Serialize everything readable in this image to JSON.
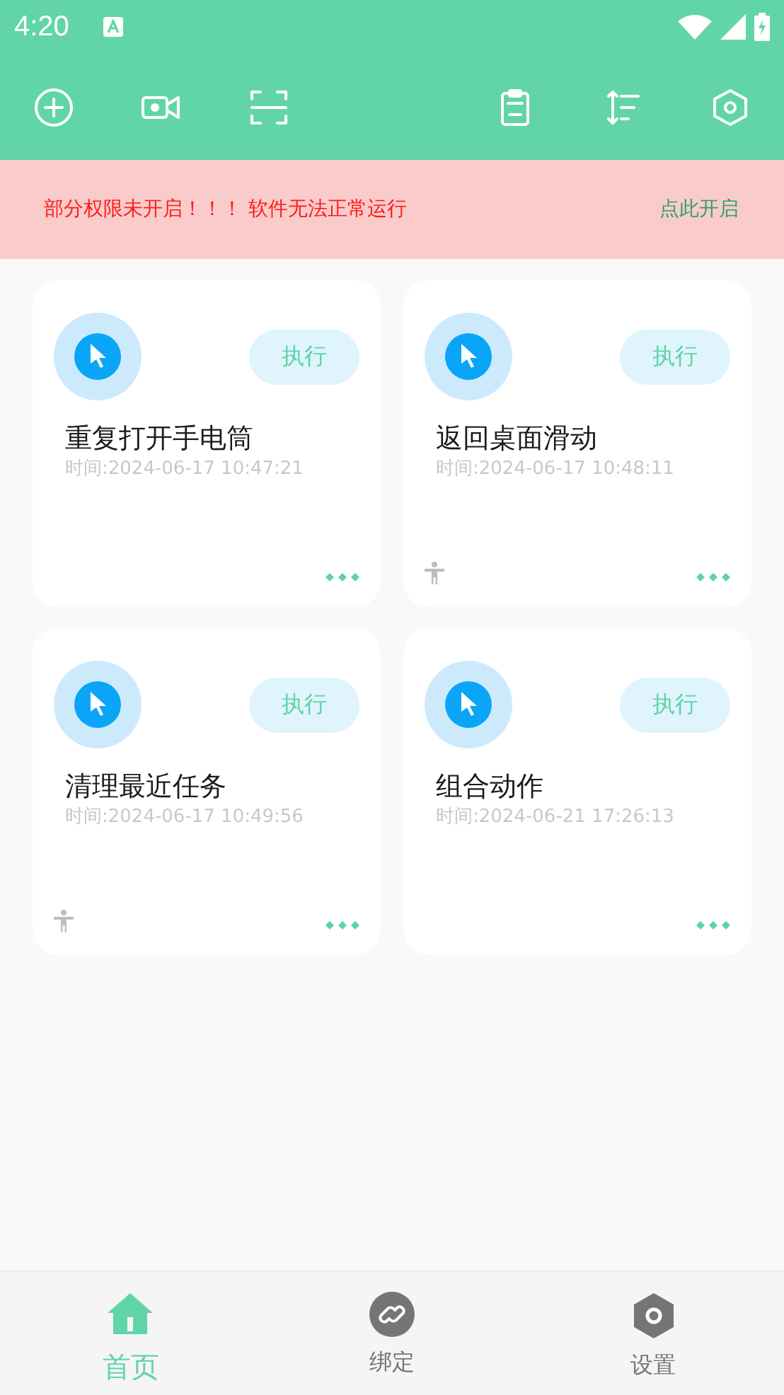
{
  "status_bar": {
    "time": "4:20"
  },
  "banner": {
    "message": "部分权限未开启！！！ 软件无法正常运行",
    "action": "点此开启"
  },
  "cards": [
    {
      "title": "重复打开手电筒",
      "time": "时间:2024-06-17 10:47:21",
      "button": "执行",
      "accessibility": false
    },
    {
      "title": "返回桌面滑动",
      "time": "时间:2024-06-17 10:48:11",
      "button": "执行",
      "accessibility": true
    },
    {
      "title": "清理最近任务",
      "time": "时间:2024-06-17 10:49:56",
      "button": "执行",
      "accessibility": true
    },
    {
      "title": "组合动作",
      "time": "时间:2024-06-21 17:26:13",
      "button": "执行",
      "accessibility": false
    }
  ],
  "bottom_nav": [
    {
      "kind": "home",
      "label": "首页",
      "selected": true
    },
    {
      "kind": "link",
      "label": "绑定",
      "selected": false
    },
    {
      "kind": "settings",
      "label": "设置",
      "selected": false
    }
  ]
}
